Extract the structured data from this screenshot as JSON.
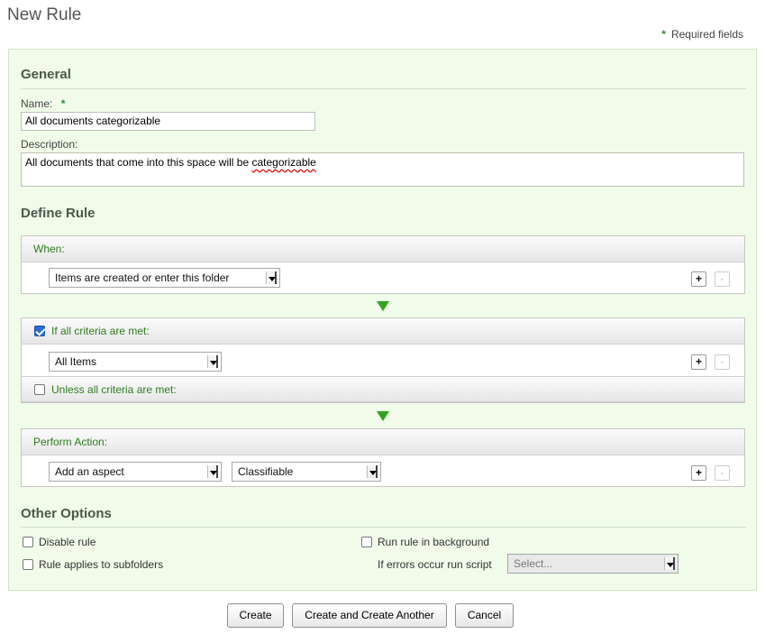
{
  "header": {
    "title": "New Rule",
    "required_star": "*",
    "required_note": "Required fields"
  },
  "general": {
    "heading": "General",
    "name_label": "Name:",
    "name_star": "*",
    "name_value": "All documents categorizable",
    "description_label": "Description:",
    "description_value_prefix": "All documents that come into this space will be ",
    "description_value_misspelled": "categorizable"
  },
  "define_rule": {
    "heading": "Define Rule",
    "when": {
      "label": "When:",
      "select_value": "Items are created or enter this folder"
    },
    "criteria": {
      "label": "If all criteria are met:",
      "checked": true,
      "select_value": "All Items"
    },
    "unless": {
      "label": "Unless all criteria are met:",
      "checked": false
    },
    "action": {
      "label": "Perform Action:",
      "select_value": "Add an aspect",
      "aspect_value": "Classifiable"
    },
    "add_symbol": "+",
    "remove_symbol": "-"
  },
  "other_options": {
    "heading": "Other Options",
    "disable_rule": "Disable rule",
    "subfolders": "Rule applies to subfolders",
    "background": "Run rule in background",
    "errors_label": "If errors occur run script",
    "script_placeholder": "Select..."
  },
  "buttons": {
    "create": "Create",
    "create_another": "Create and Create Another",
    "cancel": "Cancel"
  },
  "colors": {
    "panel_bg": "#f0fbe9",
    "accent_green": "#2e7d1e",
    "checkbox_blue": "#2a6fd6"
  }
}
